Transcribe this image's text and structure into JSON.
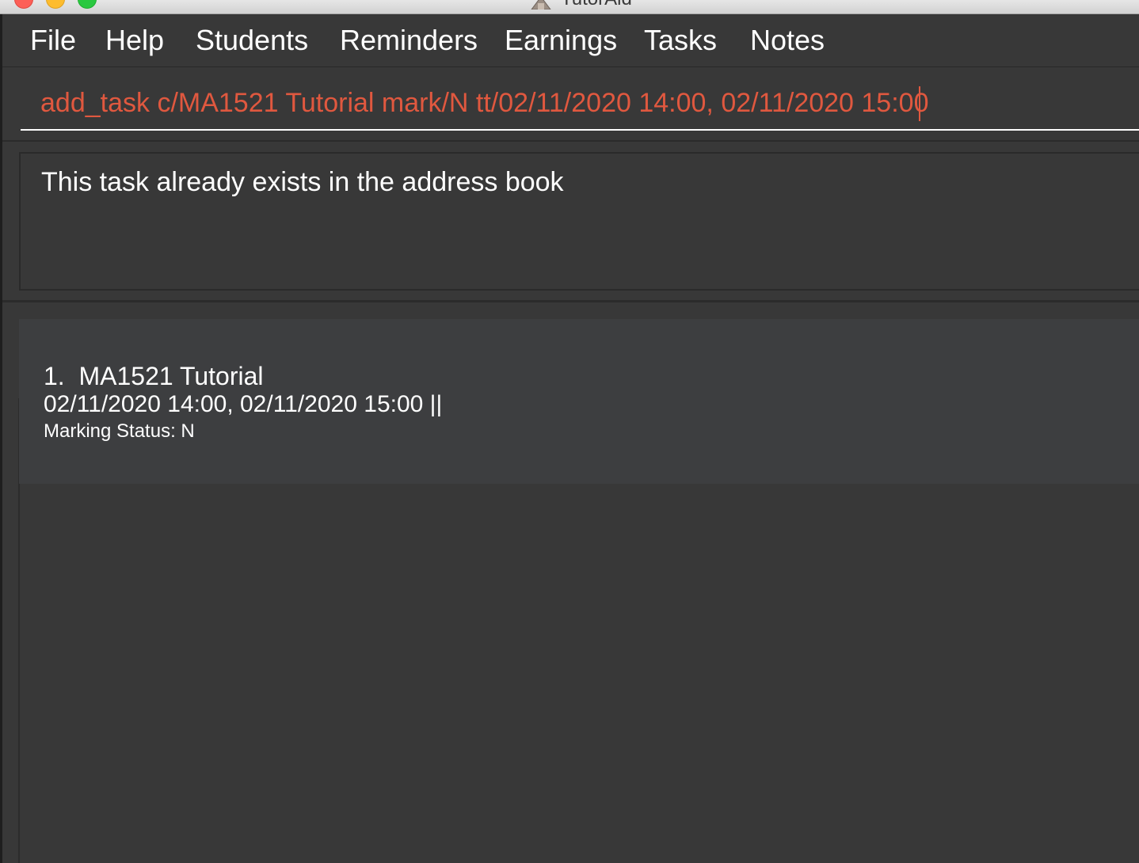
{
  "window": {
    "title": "TutorAid"
  },
  "menu": {
    "items": [
      "File",
      "Help",
      "Students",
      "Reminders",
      "Earnings",
      "Tasks",
      "Notes"
    ]
  },
  "command": {
    "value": "add_task c/MA1521 Tutorial mark/N tt/02/11/2020 14:00, 02/11/2020 15:00",
    "text_color": "#e0583f"
  },
  "result": {
    "message": "This task already exists in the address book"
  },
  "tasks": [
    {
      "index": "1.",
      "name": "MA1521 Tutorial",
      "time": "02/11/2020 14:00, 02/11/2020 15:00 ||",
      "marking_status": "Marking Status: N"
    }
  ],
  "colors": {
    "background": "#383838",
    "card": "#3d3e40",
    "text": "#ffffff"
  },
  "icons": {
    "close": "close-icon",
    "minimize": "minimize-icon",
    "maximize": "maximize-icon",
    "app": "app-icon"
  }
}
